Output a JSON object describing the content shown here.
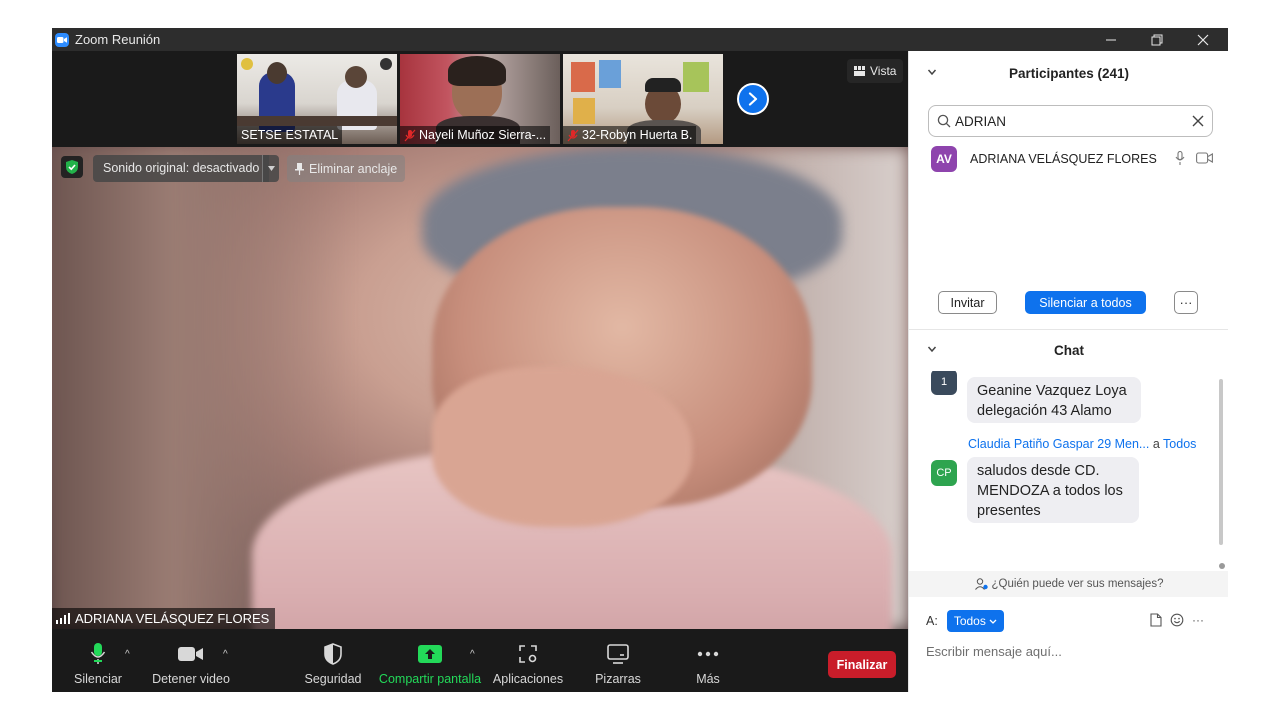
{
  "window": {
    "title": "Zoom Reunión"
  },
  "thumbnails": [
    {
      "name": "SETSE ESTATAL",
      "muted": false
    },
    {
      "name": "Nayeli Muñoz Sierra-...",
      "muted": true
    },
    {
      "name": "32-Robyn Huerta B.",
      "muted": true
    }
  ],
  "view_button": {
    "label": "Vista"
  },
  "video_controls": {
    "original_sound": "Sonido original: desactivado",
    "unpin": "Eliminar anclaje"
  },
  "active_speaker": {
    "name": "ADRIANA VELÁSQUEZ FLORES"
  },
  "toolbar": {
    "mute": "Silenciar",
    "stop_video": "Detener video",
    "security": "Seguridad",
    "share": "Compartir pantalla",
    "apps": "Aplicaciones",
    "whiteboards": "Pizarras",
    "more": "Más",
    "end": "Finalizar"
  },
  "participants": {
    "header": "Participantes (241)",
    "search_value": "ADRIAN",
    "list": [
      {
        "initials": "AV",
        "name": "ADRIANA VELÁSQUEZ FLORES",
        "avatar_color": "#8e44ad"
      }
    ],
    "invite": "Invitar",
    "mute_all": "Silenciar a todos",
    "more": "···"
  },
  "chat": {
    "header": "Chat",
    "messages": [
      {
        "avatar": "1",
        "avatar_color": "#3a4a5c",
        "lines": [
          "Geanine  Vazquez Loya",
          "delegación 43 Alamo"
        ]
      },
      {
        "sender": "Claudia Patiño Gaspar 29 Men...",
        "to_prefix": "a",
        "to": "Todos",
        "avatar": "CP",
        "avatar_color": "#2ea44f",
        "lines": [
          "saludos desde CD.",
          "MENDOZA a todos los",
          "presentes"
        ]
      }
    ],
    "who_can_see": "¿Quién puede ver sus mensajes?",
    "to_label": "A:",
    "to_value": "Todos",
    "placeholder": "Escribir mensaje aquí...",
    "more": "···"
  },
  "colors": {
    "accent": "#0e72ed",
    "end": "#c91d2a",
    "share_green": "#23d959"
  }
}
